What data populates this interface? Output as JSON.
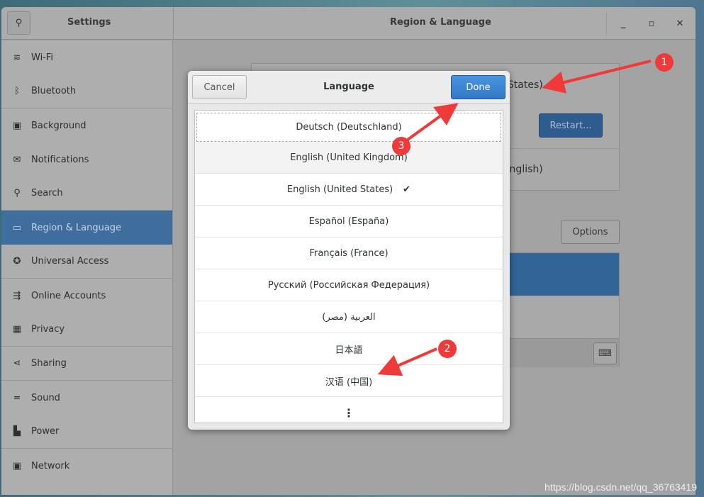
{
  "window": {
    "sidebar_title": "Settings",
    "panel_title": "Region & Language"
  },
  "sidebar": {
    "items": [
      {
        "label": "Wi-Fi",
        "icon": "wifi-icon",
        "glyph": "≋"
      },
      {
        "label": "Bluetooth",
        "icon": "bluetooth-icon",
        "glyph": "ᛒ"
      },
      {
        "label": "Background",
        "icon": "background-icon",
        "glyph": "▣"
      },
      {
        "label": "Notifications",
        "icon": "notifications-icon",
        "glyph": "✉"
      },
      {
        "label": "Search",
        "icon": "search-icon",
        "glyph": "⚲"
      },
      {
        "label": "Region & Language",
        "icon": "region-icon",
        "glyph": "▭"
      },
      {
        "label": "Universal Access",
        "icon": "universal-access-icon",
        "glyph": "✪"
      },
      {
        "label": "Online Accounts",
        "icon": "online-accounts-icon",
        "glyph": "⇶"
      },
      {
        "label": "Privacy",
        "icon": "privacy-icon",
        "glyph": "▦"
      },
      {
        "label": "Sharing",
        "icon": "sharing-icon",
        "glyph": "⋖"
      },
      {
        "label": "Sound",
        "icon": "sound-icon",
        "glyph": "≖"
      },
      {
        "label": "Power",
        "icon": "power-icon",
        "glyph": "▙"
      },
      {
        "label": "Network",
        "icon": "network-icon",
        "glyph": "▣"
      }
    ],
    "selected": "Region & Language"
  },
  "background": {
    "language_value": "English (United States)",
    "restart_label": "Restart...",
    "formats_value": "United States (English)",
    "options_label": "Options"
  },
  "dialog": {
    "title": "Language",
    "cancel_label": "Cancel",
    "done_label": "Done",
    "languages": [
      "Deutsch (Deutschland)",
      "English (United Kingdom)",
      "English (United States)",
      "Español (España)",
      "Français (France)",
      "Русский (Российская Федерация)",
      "العربية (مصر)",
      "日本語",
      "汉语 (中国)"
    ],
    "checked": "English (United States)",
    "more_label": "⋮"
  },
  "annotations": [
    "1",
    "2",
    "3"
  ],
  "watermark": "https://blog.csdn.net/qq_36763419",
  "colors": {
    "accent": "#3f6e9e",
    "done": "#3c85d4",
    "annotation": "#f03a3a"
  }
}
